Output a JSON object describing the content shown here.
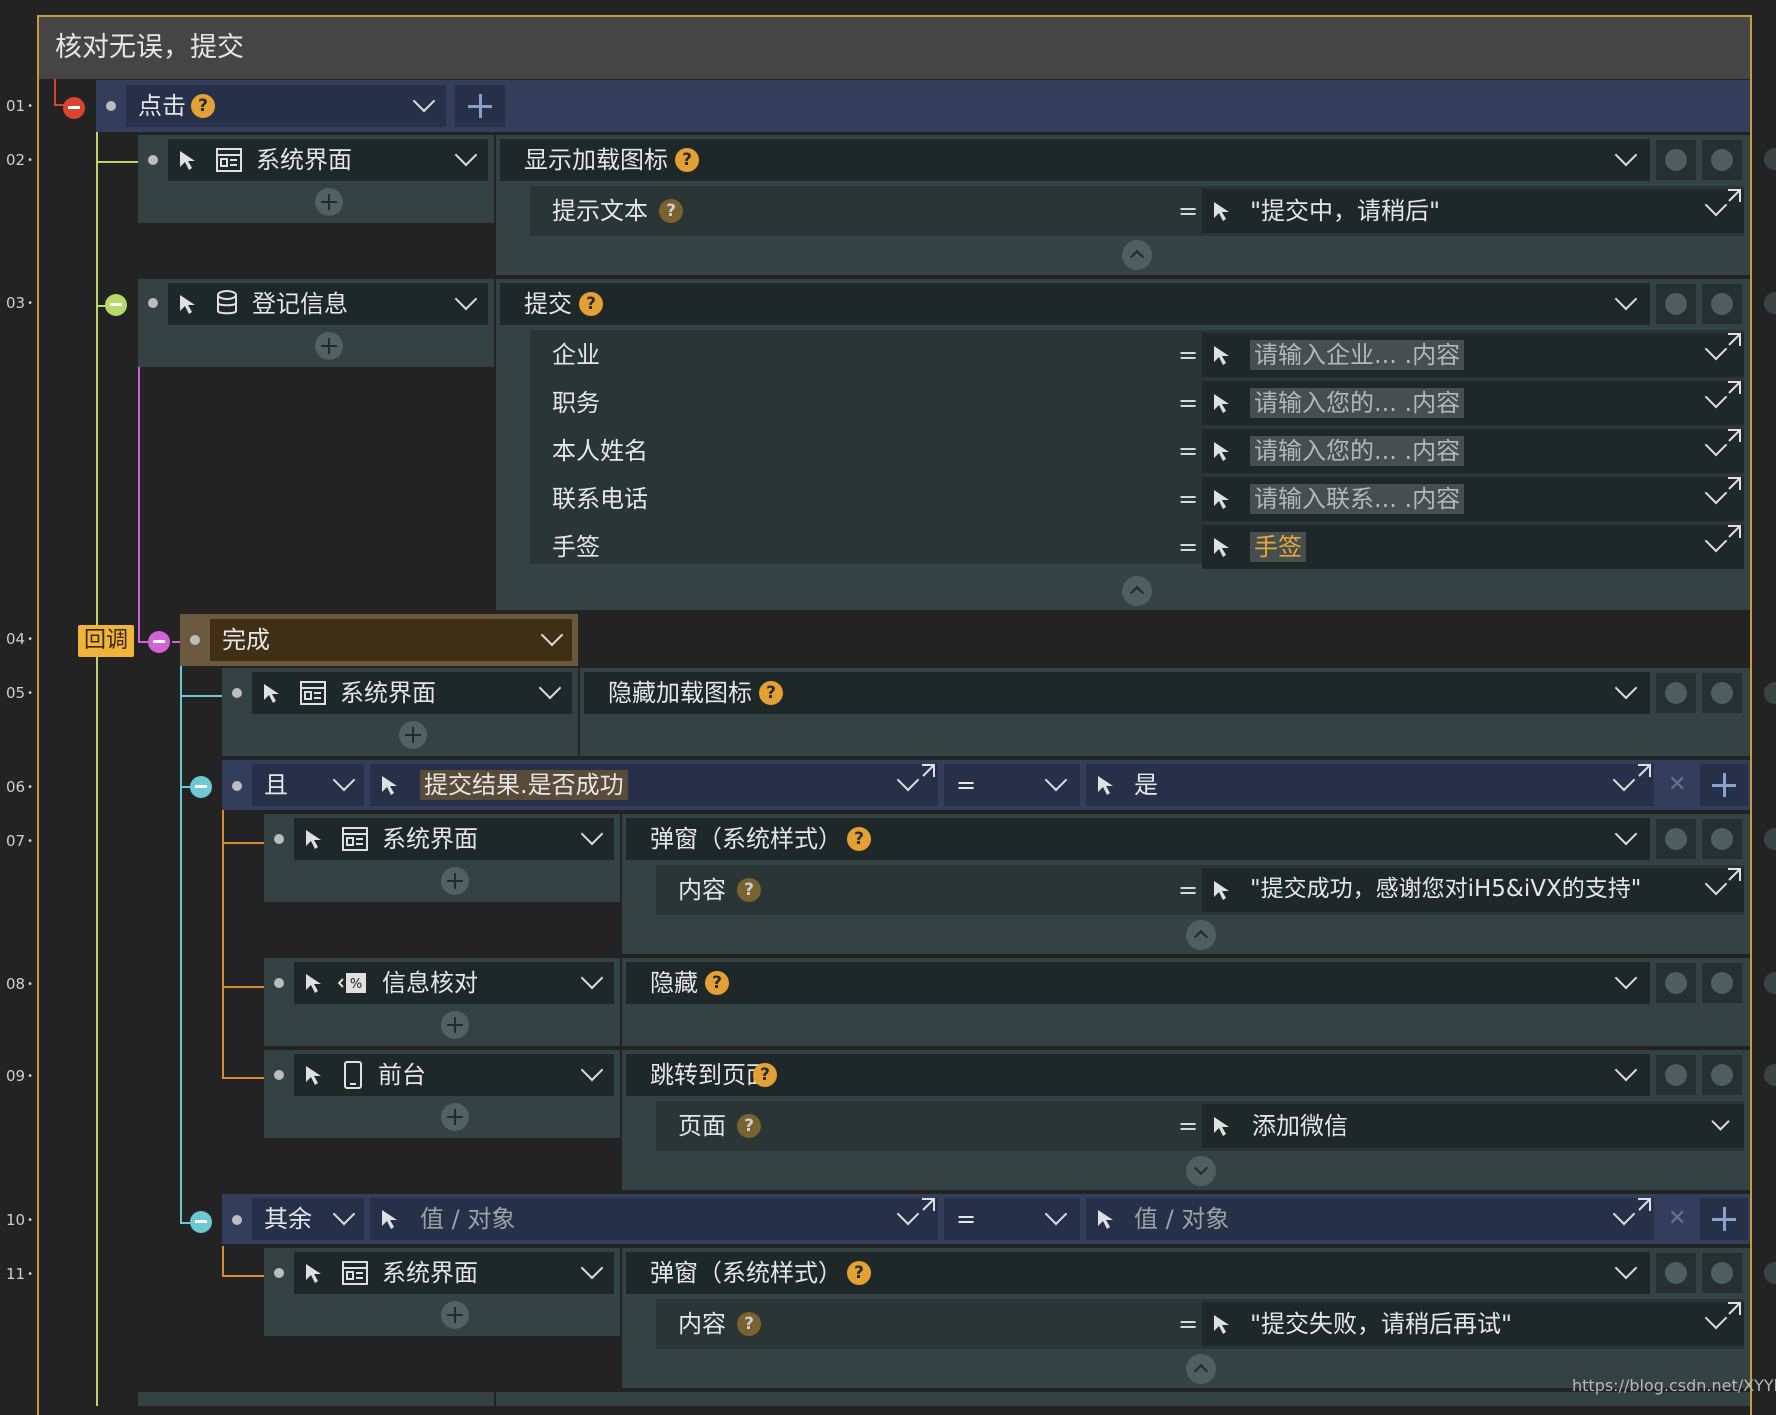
{
  "title": "核对无误，提交",
  "line_numbers": [
    "01",
    "02",
    "03",
    "04",
    "05",
    "06",
    "07",
    "08",
    "09",
    "10",
    "11"
  ],
  "trigger": {
    "label": "点击",
    "add_icon": "plus-icon"
  },
  "action02": {
    "target": "系统界面",
    "target_icon": "window-icon",
    "method": "显示加载图标",
    "params": [
      {
        "label": "提示文本",
        "value": "\"提交中，请稍后\""
      }
    ]
  },
  "action03": {
    "target": "登记信息",
    "target_icon": "database-icon",
    "method": "提交",
    "params": [
      {
        "label": "企业",
        "value": "请输入企业...  .内容"
      },
      {
        "label": "职务",
        "value": "请输入您的...  .内容"
      },
      {
        "label": "本人姓名",
        "value": "请输入您的...  .内容"
      },
      {
        "label": "联系电话",
        "value": "请输入联系...  .内容"
      },
      {
        "label": "手签",
        "value": "手签"
      }
    ]
  },
  "callback": {
    "badge": "回调",
    "event": "完成"
  },
  "action05": {
    "target": "系统界面",
    "target_icon": "window-icon",
    "method": "隐藏加载图标"
  },
  "condition06": {
    "logic": "且",
    "left": "提交结果.是否成功",
    "op": "=",
    "right": "是"
  },
  "action07": {
    "target": "系统界面",
    "target_icon": "window-icon",
    "method": "弹窗（系统样式）",
    "params": [
      {
        "label": "内容",
        "value": "\"提交成功，感谢您对iH5&iVX的支持\""
      }
    ]
  },
  "action08": {
    "target": "信息核对",
    "target_icon": "percent-icon",
    "method": "隐藏"
  },
  "action09": {
    "target": "前台",
    "target_icon": "phone-icon",
    "method": "跳转到页面",
    "params": [
      {
        "label": "页面",
        "value": "添加微信"
      }
    ]
  },
  "condition10": {
    "logic": "其余",
    "left": "值 / 对象",
    "op": "=",
    "right": "值 / 对象"
  },
  "action11": {
    "target": "系统界面",
    "target_icon": "window-icon",
    "method": "弹窗（系统样式）",
    "params": [
      {
        "label": "内容",
        "value": "\"提交失败，请稍后再试\""
      }
    ]
  },
  "watermark": "https://blog.csdn.net/XYYb",
  "colors": {
    "frame": "#c89a3e",
    "accent_orange": "#e3a133",
    "trigger_red": "#d9432f",
    "line_lime": "#b9d86a",
    "line_magenta": "#d163d6",
    "line_cyan": "#6cc9d4",
    "line_orange": "#d98a2e"
  }
}
